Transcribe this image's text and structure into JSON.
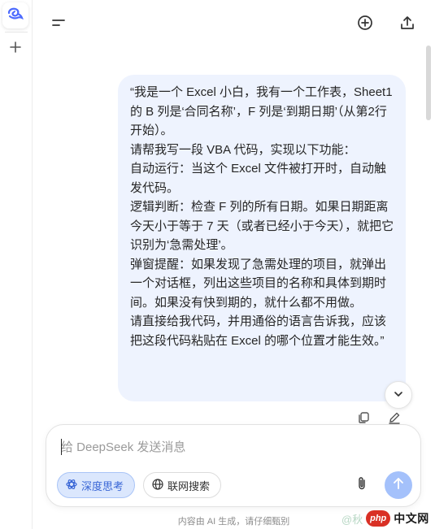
{
  "sidebar": {
    "logo_icon": "deepseek-whale-icon",
    "new_chat_icon": "plus-icon"
  },
  "topbar": {
    "menu_icon": "menu-icon",
    "new_chat_icon": "plus-circle-icon",
    "share_icon": "share-icon"
  },
  "message": {
    "text": "“我是一个 Excel 小白，我有一个工作表，Sheet1 的 B 列是‘合同名称’，F 列是‘到期日期’（从第2行开始）。\n请帮我写一段 VBA 代码，实现以下功能：\n自动运行：当这个 Excel 文件被打开时，自动触发代码。\n逻辑判断：检查 F 列的所有日期。如果日期距离今天小于等于 7 天（或者已经小于今天），就把它识别为‘急需处理’。\n弹窗提醒：如果发现了急需处理的项目，就弹出一个对话框，列出这些项目的名称和具体到期时间。如果没有快到期的，就什么都不用做。\n请直接给我代码，并用通俗的语言告诉我，应该把这段代码粘贴在 Excel 的哪个位置才能生效。”",
    "actions": [
      "copy-icon",
      "edit-icon"
    ]
  },
  "scroll_down_icon": "chevron-down-icon",
  "composer": {
    "placeholder": "给 DeepSeek 发送消息",
    "value": "",
    "deep_think_label": "深度思考",
    "web_search_label": "联网搜索",
    "attach_icon": "paperclip-icon",
    "send_icon": "arrow-up-icon"
  },
  "disclaimer": "内容由 AI 生成，请仔细甄别",
  "watermark": {
    "ghost_text": "@秋",
    "php_text": "php",
    "cn_text": "中文网"
  },
  "colors": {
    "bubble_bg": "#eef3fe",
    "accent": "#3966d6",
    "send_disabled": "#a4c1fb",
    "brand": "#4d6bfe"
  }
}
